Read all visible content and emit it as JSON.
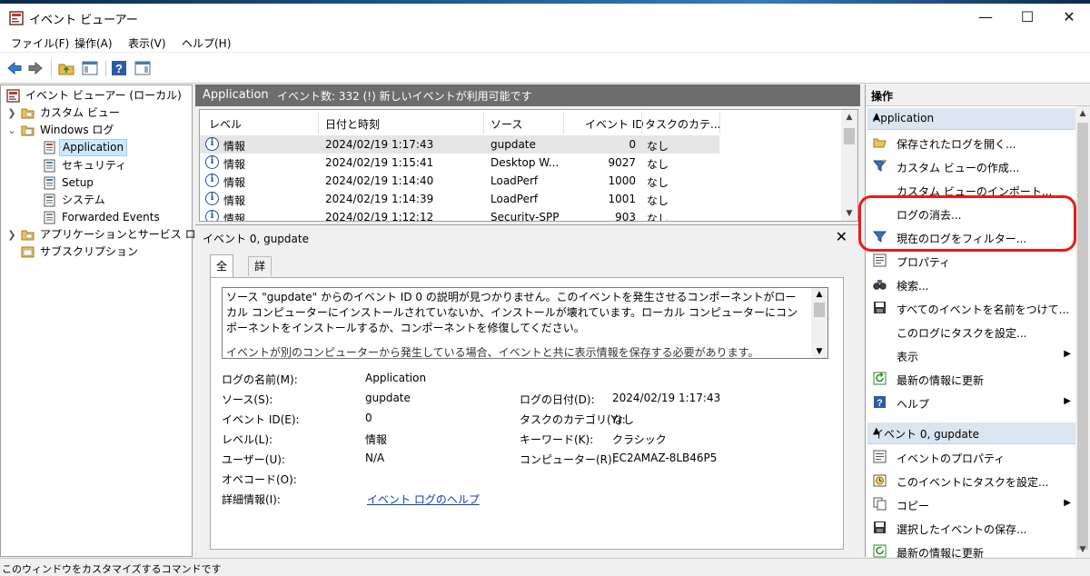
{
  "window": {
    "title": "イベント ビューアー",
    "minimize": "—",
    "maximize": "☐",
    "close": "✕"
  },
  "menu": [
    "ファイル(F)",
    "操作(A)",
    "表示(V)",
    "ヘルプ(H)"
  ],
  "tree": {
    "root": "イベント ビューアー (ローカル)",
    "custom_views": "カスタム ビュー",
    "windows_logs": "Windows ログ",
    "logs": [
      "Application",
      "セキュリティ",
      "Setup",
      "システム",
      "Forwarded Events"
    ],
    "app_service_logs": "アプリケーションとサービス ログ",
    "subscriptions": "サブスクリプション"
  },
  "header": {
    "log_name": "Application",
    "status": "イベント数: 332 (!) 新しいイベントが利用可能です"
  },
  "columns": [
    "レベル",
    "日付と時刻",
    "ソース",
    "イベント ID",
    "タスクのカテ..."
  ],
  "events": [
    {
      "level": "情報",
      "datetime": "2024/02/19 1:17:43",
      "source": "gupdate",
      "id": "0",
      "task": "なし"
    },
    {
      "level": "情報",
      "datetime": "2024/02/19 1:15:41",
      "source": "Desktop W...",
      "id": "9027",
      "task": "なし"
    },
    {
      "level": "情報",
      "datetime": "2024/02/19 1:14:40",
      "source": "LoadPerf",
      "id": "1000",
      "task": "なし"
    },
    {
      "level": "情報",
      "datetime": "2024/02/19 1:14:39",
      "source": "LoadPerf",
      "id": "1001",
      "task": "なし"
    },
    {
      "level": "情報",
      "datetime": "2024/02/19 1:12:12",
      "source": "Security-SPP",
      "id": "903",
      "task": "なし"
    }
  ],
  "detail": {
    "title": "イベント 0, gupdate",
    "tabs": [
      "全般",
      "詳細"
    ],
    "description": "ソース \"gupdate\" からのイベント ID 0 の説明が見つかりません。このイベントを発生させるコンポーネントがローカル コンピューターにインストールされていないか、インストールが壊れています。ローカル コンピューターにコンポーネントをインストールするか、コンポーネントを修復してください。",
    "description_more": "イベントが別のコンピューターから発生している場合、イベントと共に表示情報を保存する必要があります。",
    "labels": {
      "log_name": "ログの名前(M):",
      "source": "ソース(S):",
      "event_id": "イベント ID(E):",
      "level": "レベル(L):",
      "user": "ユーザー(U):",
      "opcode": "オペコード(O):",
      "more_info": "詳細情報(I):",
      "logged": "ログの日付(D):",
      "task_category": "タスクのカテゴリ(Y):",
      "keywords": "キーワード(K):",
      "computer": "コンピューター(R):"
    },
    "values": {
      "log_name": "Application",
      "source": "gupdate",
      "event_id": "0",
      "level": "情報",
      "user": "N/A",
      "more_info": "イベント ログのヘルプ",
      "logged": "2024/02/19 1:17:43",
      "task_category": "なし",
      "keywords": "クラシック",
      "computer": "EC2AMAZ-8LB46P5"
    }
  },
  "actions": {
    "title": "操作",
    "section1": "Application",
    "items1": [
      {
        "label": "保存されたログを開く...",
        "icon": "folder-icon"
      },
      {
        "label": "カスタム ビューの作成...",
        "icon": "filter-icon"
      },
      {
        "label": "カスタム ビューのインポート...",
        "icon": ""
      },
      {
        "label": "ログの消去...",
        "icon": ""
      },
      {
        "label": "現在のログをフィルター...",
        "icon": "filter-icon"
      },
      {
        "label": "プロパティ",
        "icon": "properties-icon"
      },
      {
        "label": "検索...",
        "icon": "binoculars-icon"
      },
      {
        "label": "すべてのイベントを名前をつけて...",
        "icon": "save-icon"
      },
      {
        "label": "このログにタスクを設定...",
        "icon": ""
      },
      {
        "label": "表示",
        "icon": ""
      },
      {
        "label": "最新の情報に更新",
        "icon": "refresh-icon"
      },
      {
        "label": "ヘルプ",
        "icon": "help-icon"
      }
    ],
    "section2": "イベント 0, gupdate",
    "items2": [
      {
        "label": "イベントのプロパティ",
        "icon": "properties-icon"
      },
      {
        "label": "このイベントにタスクを設定...",
        "icon": "task-icon"
      },
      {
        "label": "コピー",
        "icon": "copy-icon"
      },
      {
        "label": "選択したイベントの保存...",
        "icon": "save-icon"
      },
      {
        "label": "最新の情報に更新",
        "icon": "refresh-icon"
      }
    ]
  },
  "statusbar": "このウィンドウをカスタマイズするコマンドです",
  "colors": {
    "header": "#6d6d6d",
    "section": "#dbe5ef",
    "selection": "#cce8ff",
    "annotation": "#f01818",
    "link": "#0645ad"
  }
}
